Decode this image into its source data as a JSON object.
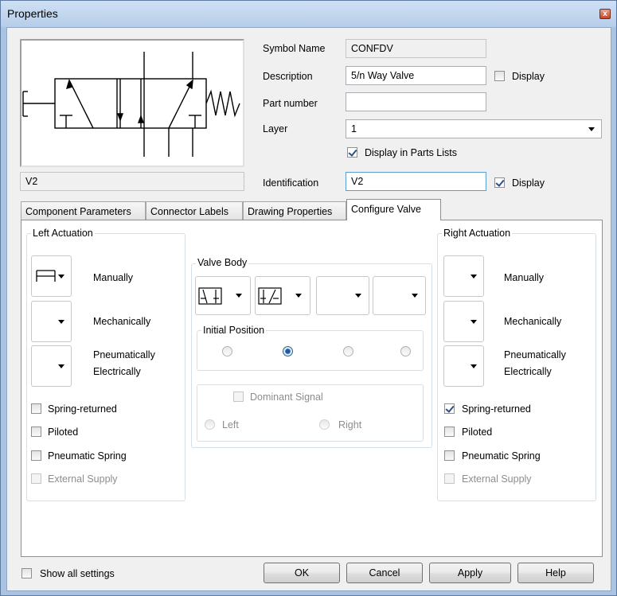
{
  "window": {
    "title": "Properties",
    "close_glyph": "x"
  },
  "symbol": {
    "preview_label": "V2"
  },
  "fields": {
    "symbol_name_label": "Symbol Name",
    "symbol_name_value": "CONFDV",
    "description_label": "Description",
    "description_value": "5/n Way Valve",
    "description_display_label": "Display",
    "part_number_label": "Part number",
    "part_number_value": "",
    "layer_label": "Layer",
    "layer_value": "1",
    "display_in_parts_lists_label": "Display in Parts Lists",
    "identification_label": "Identification",
    "identification_value": "V2",
    "identification_display_label": "Display"
  },
  "tabs": [
    "Component Parameters",
    "Connector Labels",
    "Drawing Properties",
    "Configure Valve"
  ],
  "left_actuation": {
    "title": "Left Actuation",
    "manually": "Manually",
    "mechanically": "Mechanically",
    "pneumatically": "Pneumatically",
    "electrically": "Electrically",
    "spring_returned": "Spring-returned",
    "piloted": "Piloted",
    "pneumatic_spring": "Pneumatic Spring",
    "external_supply": "External Supply"
  },
  "right_actuation": {
    "title": "Right Actuation",
    "manually": "Manually",
    "mechanically": "Mechanically",
    "pneumatically": "Pneumatically",
    "electrically": "Electrically",
    "spring_returned": "Spring-returned",
    "piloted": "Piloted",
    "pneumatic_spring": "Pneumatic Spring",
    "external_supply": "External Supply"
  },
  "valve_body": {
    "title": "Valve Body",
    "initial_position_title": "Initial Position",
    "dominant_signal_label": "Dominant Signal",
    "left_label": "Left",
    "right_label": "Right"
  },
  "footer": {
    "show_all_settings": "Show all settings",
    "ok": "OK",
    "cancel": "Cancel",
    "apply": "Apply",
    "help": "Help"
  },
  "colors": {
    "title_bar": "#b6cde9",
    "client": "#f0f0f0",
    "accent": "#1e5a9e"
  }
}
